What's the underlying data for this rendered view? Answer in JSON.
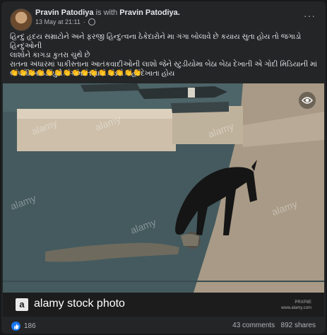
{
  "post": {
    "author": "Pravin Patodiya",
    "with_text": "is with",
    "tagged": "Pravin Patodiya.",
    "timestamp": "13 May at 21:11",
    "meta_separator": "·",
    "more_label": "···",
    "text_lines": [
      "હિન્દુ હૃદય સમ્રાટોને અને ફરજી હિન્દુત્વના ઠેકેદારોને મા ગંગા બોલાવે છે કયાય સુતા હોય તો જગાડો હિન્દુઓની",
      "લાશોને કાગડા કુતરા ચુથે છે",
      "રાતના અંધારમાં પાકીસ્તાના આતંકવાદીઓની લાશો જેને સ્ટુડીયોમા બેઠા બેઠા દેખાતી એ ગોદી મિડિયાની માં",
      "બાપની બાઇડીયુને ગંગામા તણાતા મડદા નહી દેખાતા હોય"
    ],
    "emojis": "👏👏👏👏👏👏👏👏👏👏👏👏👏👏👏"
  },
  "image": {
    "watermarks": [
      "alamy",
      "alamy",
      "alamy",
      "alamy",
      "alamy",
      "alamy"
    ],
    "stock_label": "alamy stock photo",
    "logo_letter": "a",
    "image_id": "PRXP8E",
    "site": "www.alamy.com"
  },
  "engagement": {
    "likes": "186",
    "comments": "43 comments",
    "shares": "892 shares"
  },
  "colors": {
    "background": "#18191a",
    "card": "#242526",
    "text": "#e4e6eb",
    "muted": "#b0b3b8",
    "like_blue": "#1877f2"
  }
}
